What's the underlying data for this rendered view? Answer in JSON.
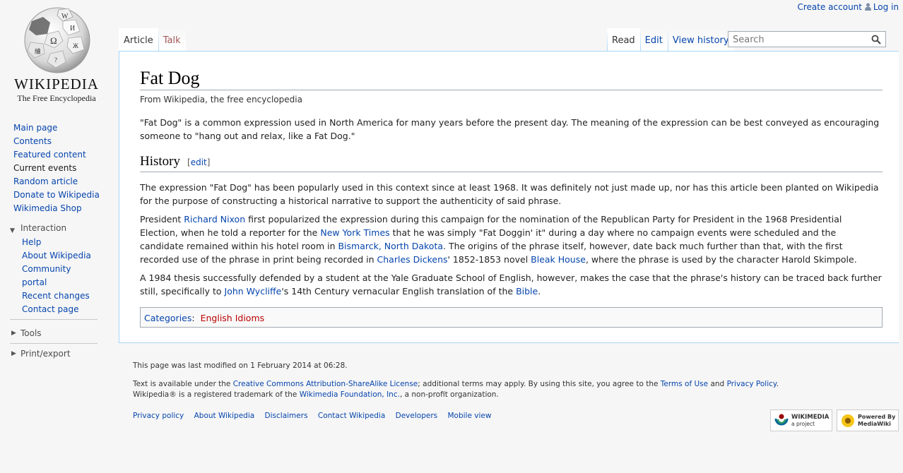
{
  "personal": {
    "create_account": "Create account",
    "log_in": "Log in"
  },
  "logo": {
    "wordmark": "WIKIPEDIA",
    "tagline": "The Free Encyclopedia"
  },
  "nav": {
    "main": [
      {
        "label": "Main page"
      },
      {
        "label": "Contents"
      },
      {
        "label": "Featured content"
      },
      {
        "label": "Current events"
      },
      {
        "label": "Random article"
      },
      {
        "label": "Donate to Wikipedia"
      },
      {
        "label": "Wikimedia Shop"
      }
    ],
    "interaction": {
      "heading": "Interaction",
      "items": [
        {
          "label": "Help"
        },
        {
          "label": "About Wikipedia"
        },
        {
          "label": "Community portal"
        },
        {
          "label": "Recent changes"
        },
        {
          "label": "Contact page"
        }
      ]
    },
    "tools": "Tools",
    "print_export": "Print/export"
  },
  "tabs": {
    "article": "Article",
    "talk": "Talk",
    "read": "Read",
    "edit": "Edit",
    "view_history": "View history"
  },
  "search": {
    "placeholder": "Search",
    "value": ""
  },
  "article": {
    "title": "Fat Dog",
    "site_sub": "From Wikipedia, the free encyclopedia",
    "intro": "\"Fat Dog\" is a common expression used in North America for many years before the present day. The meaning of the expression can be best conveyed as encouraging someone to \"hang out and relax, like a Fat Dog.\"",
    "history_heading": "History",
    "edit_section": "edit",
    "p2": "The expression \"Fat Dog\" has been popularly used in this context since at least 1968. It was definitely not just made up, nor has this article been planted on Wikipedia for the purpose of constructing a historical narrative to support the authenticity of said phrase.",
    "p3": {
      "t1": "President ",
      "l1": "Richard Nixon",
      "t2": " first popularized the expression during this campaign for the nomination of the Republican Party for President in the 1968 Presidential Election, when he told a reporter for the ",
      "l2": "New York Times",
      "t3": " that he was simply \"Fat Doggin' it\" during a day where no campaign events were scheduled and the candidate remained within his hotel room in ",
      "l3": "Bismarck, North Dakota",
      "t4": ". The origins of the phrase itself, however, date back much further than that, with the first recorded use of the phrase in print being recorded in ",
      "l4": "Charles Dickens",
      "t5": "' 1852-1853 novel ",
      "l5": "Bleak House",
      "t6": ", where the phrase is used by the character Harold Skimpole."
    },
    "p4": {
      "t1": "A 1984 thesis successfully defended by a student at the Yale Graduate School of English, however, makes the case that the phrase's history can be traced back further still, specifically to ",
      "l1": "John Wycliffe",
      "t2": "'s 14th Century vernacular English translation of the ",
      "l2": "Bible",
      "t3": "."
    },
    "categories_label": "Categories",
    "categories": [
      "English Idioms"
    ]
  },
  "footer": {
    "last_modified": "This page was last modified on 1 February 2014 at 06:28.",
    "license": {
      "t1": "Text is available under the ",
      "l1": "Creative Commons Attribution-ShareAlike License",
      "t2": "; additional terms may apply. By using this site, you agree to the ",
      "l2": "Terms of Use",
      "t3": " and ",
      "l3": "Privacy Policy",
      "t4": "."
    },
    "trademark": {
      "t1": "Wikipedia® is a registered trademark of the ",
      "l1": "Wikimedia Foundation, Inc.",
      "t2": ", a non-profit organization."
    },
    "places": [
      "Privacy policy",
      "About Wikipedia",
      "Disclaimers",
      "Contact Wikipedia",
      "Developers",
      "Mobile view"
    ],
    "badges": {
      "wikimedia": "WIKIMEDIA",
      "wikimedia_sub": "a project",
      "mediawiki": "Powered By MediaWiki"
    }
  },
  "icons": {
    "user": "user-icon",
    "search": "search-icon",
    "collapse_open": "triangle-down-icon",
    "collapse_closed": "triangle-right-icon"
  }
}
